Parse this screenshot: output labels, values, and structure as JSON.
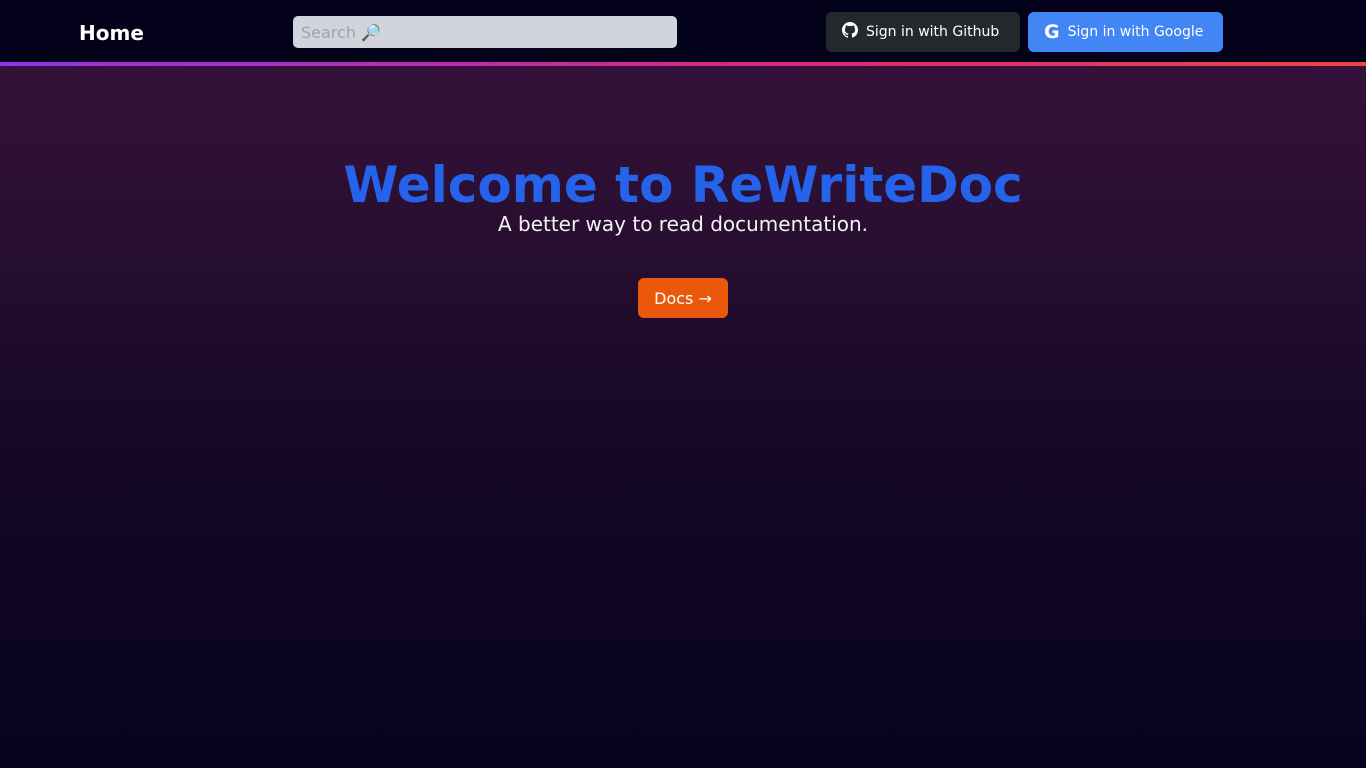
{
  "nav": {
    "home": "Home",
    "search_placeholder": "Search 🔎",
    "github": "Sign in with Github",
    "google": "Sign in with Google"
  },
  "hero": {
    "title": "Welcome to ReWriteDoc",
    "subtitle": "A better way to read documentation.",
    "docs_button": "Docs →"
  }
}
